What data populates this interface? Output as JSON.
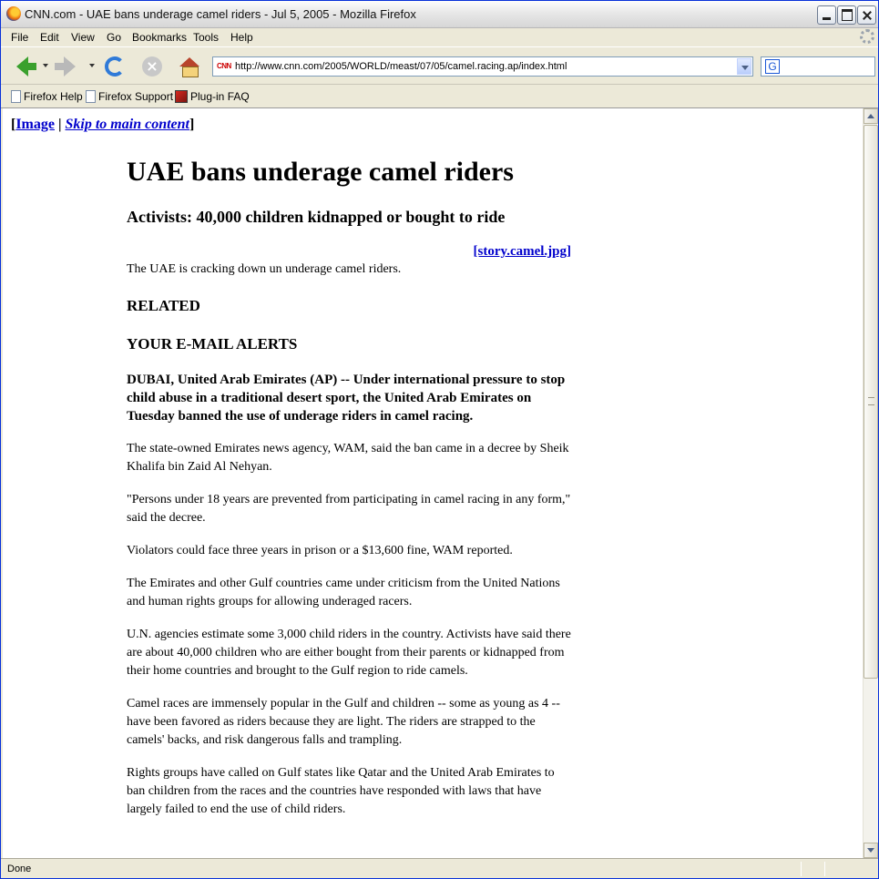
{
  "window": {
    "title": "CNN.com - UAE bans underage camel riders - Jul 5, 2005 - Mozilla Firefox"
  },
  "menu": {
    "items": [
      "File",
      "Edit",
      "View",
      "Go",
      "Bookmarks",
      "Tools",
      "Help"
    ]
  },
  "toolbar": {
    "url": "http://www.cnn.com/2005/WORLD/meast/07/05/camel.racing.ap/index.html",
    "site_icon_text": "CNN",
    "search_value": "",
    "search_engine_icon": "G"
  },
  "bookmarks": {
    "items": [
      "Firefox Help",
      "Firefox Support",
      "Plug-in FAQ"
    ]
  },
  "page": {
    "skip_links": {
      "image": "Image",
      "separator": "|",
      "skip": "Skip to main content",
      "open_bracket": "[",
      "close_bracket": "]"
    },
    "headline": "UAE bans underage camel riders",
    "subhead": "Activists: 40,000 children kidnapped or bought to ride",
    "image_link": "[story.camel.jpg]",
    "image_caption": "The UAE is cracking down un underage camel riders.",
    "sections": [
      "RELATED",
      "YOUR E-MAIL ALERTS"
    ],
    "lead": "DUBAI, United Arab Emirates (AP) -- Under international pressure to stop child abuse in a traditional desert sport, the United Arab Emirates on Tuesday banned the use of underage riders in camel racing.",
    "paragraphs": [
      "The state-owned Emirates news agency, WAM, said the ban came in a decree by Sheik Khalifa bin Zaid Al Nehyan.",
      "\"Persons under 18 years are prevented from participating in camel racing in any form,\" said the decree.",
      "Violators could face three years in prison or a $13,600 fine, WAM reported.",
      "The Emirates and other Gulf countries came under criticism from the United Nations and human rights groups for allowing underaged racers.",
      "U.N. agencies estimate some 3,000 child riders in the country. Activists have said there are about 40,000 children who are either bought from their parents or kidnapped from their home countries and brought to the Gulf region to ride camels.",
      "Camel races are immensely popular in the Gulf and children -- some as young as 4 -- have been favored as riders because they are light. The riders are strapped to the camels' backs, and risk dangerous falls and trampling.",
      "Rights groups have called on Gulf states like Qatar and the United Arab Emirates to ban children from the races and the countries have responded with laws that have largely failed to end the use of child riders."
    ]
  },
  "status": {
    "text": "Done"
  }
}
